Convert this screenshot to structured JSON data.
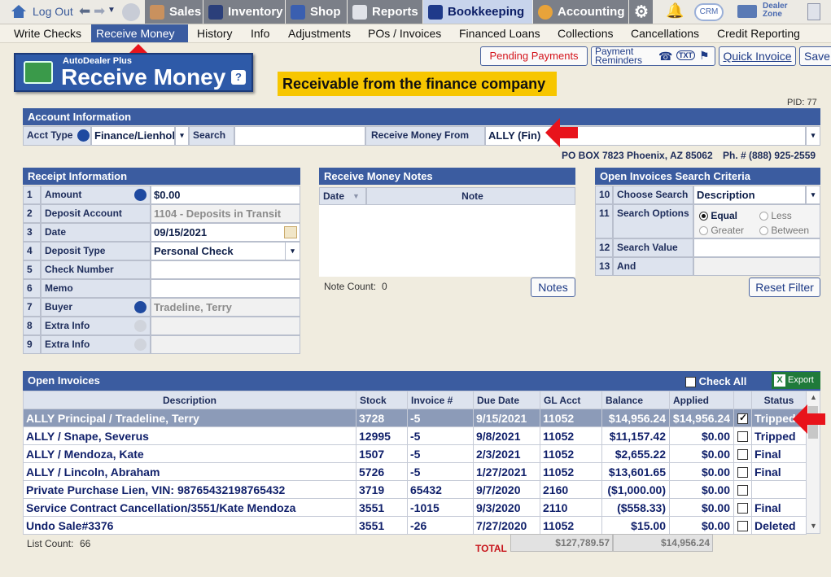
{
  "topnav": {
    "logout": "Log Out",
    "items": [
      {
        "label": "Sales",
        "icon": "sales-icon",
        "active": false
      },
      {
        "label": "Inventory",
        "icon": "car-icon",
        "active": false
      },
      {
        "label": "Shop",
        "icon": "wrench-icon",
        "active": false
      },
      {
        "label": "Reports",
        "icon": "chart-icon",
        "active": false
      },
      {
        "label": "Bookkeeping",
        "icon": "book-icon",
        "active": true
      },
      {
        "label": "Accounting",
        "icon": "pie-icon",
        "active": false
      }
    ],
    "crm": "CRM",
    "dealer_zone": [
      "Dealer",
      "Zone"
    ]
  },
  "submenu": [
    "Write Checks",
    "Receive Money",
    "History",
    "Info",
    "Adjustments",
    "POs / Invoices",
    "Financed Loans",
    "Collections",
    "Cancellations",
    "Credit Reporting"
  ],
  "header": {
    "logo_small": "AutoDealer Plus",
    "logo_big": "Receive Money",
    "help": "?",
    "banner": "Receivable from the finance company",
    "pid": "PID: 77"
  },
  "actions": {
    "pending": "Pending Payments",
    "reminders": [
      "Payment",
      "Reminders"
    ],
    "txt": "TXT",
    "quick_invoice": "Quick Invoice",
    "save": "Save"
  },
  "account": {
    "title": "Account Information",
    "acct_type_label": "Acct Type",
    "acct_type_value": "Finance/Lienholder",
    "search_label": "Search",
    "search_value": "",
    "receive_from_label": "Receive Money From",
    "receive_from_value": "ALLY  (Fin)",
    "address": "PO BOX 7823 Phoenix, AZ 85062",
    "phone": "Ph. # (888) 925-2559"
  },
  "receipt": {
    "title": "Receipt Information",
    "rows": [
      {
        "n": "1",
        "label": "Amount",
        "value": "$0.00"
      },
      {
        "n": "2",
        "label": "Deposit Account",
        "value": "1104 - Deposits in Transit"
      },
      {
        "n": "3",
        "label": "Date",
        "value": "09/15/2021"
      },
      {
        "n": "4",
        "label": "Deposit Type",
        "value": "Personal Check"
      },
      {
        "n": "5",
        "label": "Check Number",
        "value": ""
      },
      {
        "n": "6",
        "label": "Memo",
        "value": ""
      },
      {
        "n": "7",
        "label": "Buyer",
        "value": "Tradeline, Terry"
      },
      {
        "n": "8",
        "label": "Extra Info",
        "value": ""
      },
      {
        "n": "9",
        "label": "Extra Info",
        "value": ""
      }
    ]
  },
  "notes": {
    "title": "Receive Money Notes",
    "col_date": "Date",
    "col_note": "Note",
    "count_label": "Note Count:",
    "count": "0",
    "button": "Notes"
  },
  "criteria": {
    "title": "Open Invoices Search Criteria",
    "r10_n": "10",
    "r10_label": "Choose Search",
    "r10_value": "Description",
    "r11_n": "11",
    "r11_label": "Search Options",
    "options": [
      "Equal",
      "Less",
      "Greater",
      "Between"
    ],
    "r12_n": "12",
    "r12_label": "Search Value",
    "r13_n": "13",
    "r13_label": "And",
    "reset": "Reset Filter"
  },
  "invoices": {
    "title": "Open Invoices",
    "check_all": "Check All",
    "export": "Export",
    "columns": [
      "Description",
      "Stock",
      "Invoice #",
      "Due Date",
      "GL Acct",
      "Balance",
      "Applied",
      "",
      "Status"
    ],
    "rows": [
      {
        "desc": "ALLY Principal / Tradeline, Terry",
        "stock": "3728",
        "inv": "-5",
        "due": "9/15/2021",
        "gl": "11052",
        "balance": "$14,956.24",
        "applied": "$14,956.24",
        "checked": true,
        "status": "Tripped"
      },
      {
        "desc": "ALLY / Snape, Severus",
        "stock": "12995",
        "inv": "-5",
        "due": "9/8/2021",
        "gl": "11052",
        "balance": "$11,157.42",
        "applied": "$0.00",
        "checked": false,
        "status": "Tripped"
      },
      {
        "desc": "ALLY / Mendoza, Kate",
        "stock": "1507",
        "inv": "-5",
        "due": "2/3/2021",
        "gl": "11052",
        "balance": "$2,655.22",
        "applied": "$0.00",
        "checked": false,
        "status": "Final"
      },
      {
        "desc": "ALLY / Lincoln, Abraham",
        "stock": "5726",
        "inv": "-5",
        "due": "1/27/2021",
        "gl": "11052",
        "balance": "$13,601.65",
        "applied": "$0.00",
        "checked": false,
        "status": "Final"
      },
      {
        "desc": "Private Purchase Lien, VIN: 98765432198765432",
        "stock": "3719",
        "inv": "65432",
        "due": "9/7/2020",
        "gl": "2160",
        "balance": "($1,000.00)",
        "applied": "$0.00",
        "checked": false,
        "status": ""
      },
      {
        "desc": "Service Contract Cancellation/3551/Kate Mendoza",
        "stock": "3551",
        "inv": "-1015",
        "due": "9/3/2020",
        "gl": "2110",
        "balance": "($558.33)",
        "applied": "$0.00",
        "checked": false,
        "status": "Final"
      },
      {
        "desc": "Undo Sale#3376",
        "stock": "3551",
        "inv": "-26",
        "due": "7/27/2020",
        "gl": "11052",
        "balance": "$15.00",
        "applied": "$0.00",
        "checked": false,
        "status": "Deleted"
      }
    ],
    "list_count_label": "List Count:",
    "list_count": "66",
    "total_label": "TOTAL",
    "total_balance": "$127,789.57",
    "total_applied": "$14,956.24"
  },
  "colors": {
    "nav_active": "#c8d4ec",
    "panel_header": "#3b5ca0",
    "arrow": "#e8131b",
    "banner": "#f7c600"
  }
}
